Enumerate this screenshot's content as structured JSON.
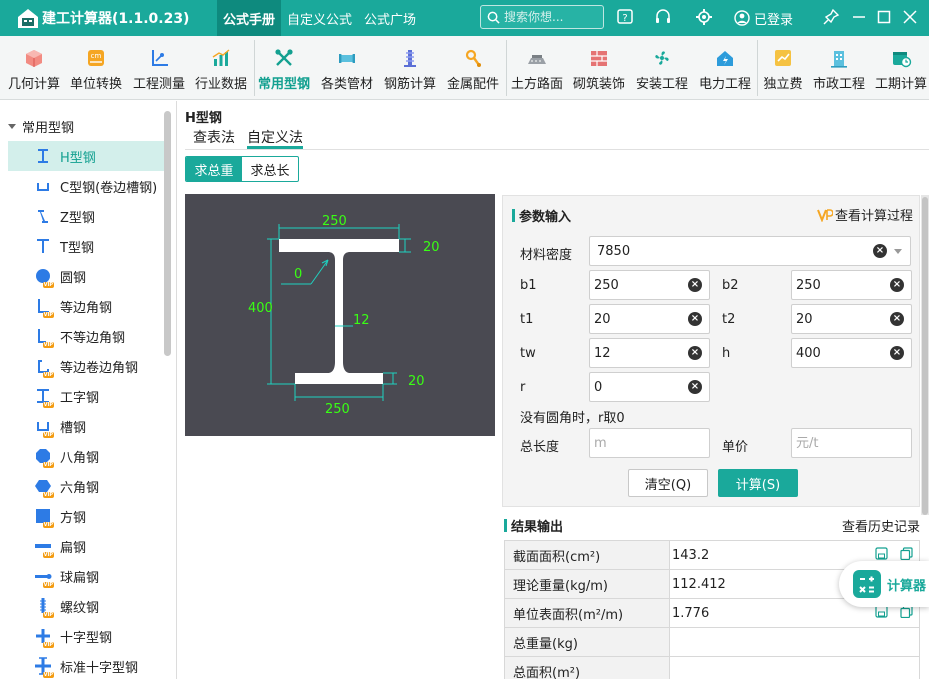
{
  "titlebar": {
    "app_title": "建工计算器(1.1.0.23)",
    "tabs": [
      "公式手册",
      "自定义公式",
      "公式广场"
    ],
    "search_placeholder": "搜索你想...",
    "login_label": "已登录"
  },
  "toolbar": {
    "items": [
      "几何计算",
      "单位转换",
      "工程测量",
      "行业数据",
      "常用型钢",
      "各类管材",
      "钢筋计算",
      "金属配件",
      "土方路面",
      "砌筑装饰",
      "安装工程",
      "电力工程",
      "独立费",
      "市政工程",
      "工期计算"
    ]
  },
  "sidebar": {
    "group_label": "常用型钢",
    "items": [
      "H型钢",
      "C型钢(卷边槽钢)",
      "Z型钢",
      "T型钢",
      "圆钢",
      "等边角钢",
      "不等边角钢",
      "等边卷边角钢",
      "工字钢",
      "槽钢",
      "八角钢",
      "六角钢",
      "方钢",
      "扁钢",
      "球扁钢",
      "螺纹钢",
      "十字型钢",
      "标准十字型钢"
    ],
    "vip_label": "VIP"
  },
  "main": {
    "title": "H型钢",
    "tabs": [
      "查表法",
      "自定义法"
    ],
    "modes": [
      "求总重",
      "求总长"
    ]
  },
  "diagram": {
    "b1": "250",
    "b2": "250",
    "t1": "20",
    "t2": "20",
    "h": "400",
    "tw": "12",
    "r": "0"
  },
  "params": {
    "section_title": "参数输入",
    "view_process": "查看计算过程",
    "density_label": "材料密度",
    "density_value": "7850",
    "b1_label": "b1",
    "b1_value": "250",
    "b2_label": "b2",
    "b2_value": "250",
    "t1_label": "t1",
    "t1_value": "20",
    "t2_label": "t2",
    "t2_value": "20",
    "tw_label": "tw",
    "tw_value": "12",
    "h_label": "h",
    "h_value": "400",
    "r_label": "r",
    "r_value": "0",
    "note": "没有圆角时，r取0",
    "total_length_label": "总长度",
    "total_length_placeholder": "m",
    "unit_price_label": "单价",
    "unit_price_placeholder": "元/t",
    "clear_button": "清空(Q)",
    "calc_button": "计算(S)"
  },
  "results": {
    "section_title": "结果输出",
    "history_link": "查看历史记录",
    "rows": [
      {
        "label": "截面面积(cm²)",
        "value": "143.2"
      },
      {
        "label": "理论重量(kg/m)",
        "value": "112.412"
      },
      {
        "label": "单位表面积(m²/m)",
        "value": "1.776"
      },
      {
        "label": "总重量(kg)",
        "value": ""
      },
      {
        "label": "总面积(m²)",
        "value": ""
      }
    ]
  },
  "float_calc": {
    "label": "计算器"
  },
  "colors": {
    "accent": "#1aa99b",
    "accent_dark": "#0e8a7e",
    "diagram_bg": "#4a4a52",
    "dimension_text": "#39ff14"
  }
}
